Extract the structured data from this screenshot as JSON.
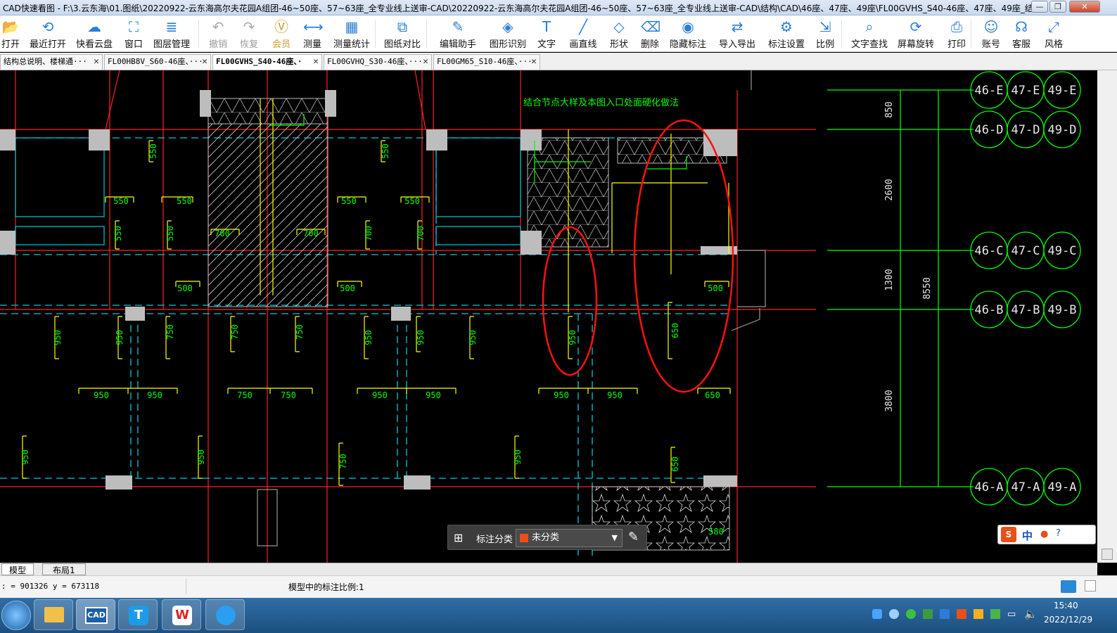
{
  "window": {
    "title": "CAD快速看图 - F:\\3.云东海\\01.图纸\\20220922-云东海高尔夫花园A组团-46~50座、57~63座_全专业线上送审-CAD\\20220922-云东海高尔夫花园A组团-46~50座、57~63座_全专业线上送审-CAD\\结构\\CAD\\46座、47座、49座\\FL00GVHS_S40-46座、47座、49座_结...",
    "min_label": "—",
    "max_label": "❐",
    "close_label": "✕"
  },
  "toolbar": {
    "items": [
      {
        "label": "打开",
        "icon": "folder-open-icon"
      },
      {
        "label": "最近打开",
        "icon": "recent-clock-icon"
      },
      {
        "label": "快看云盘",
        "icon": "cloud-icon"
      },
      {
        "label": "窗口",
        "icon": "window-fit-icon"
      },
      {
        "label": "图层管理",
        "icon": "layers-icon"
      },
      {
        "label": "撤销",
        "icon": "undo-icon"
      },
      {
        "label": "恢复",
        "icon": "redo-icon"
      },
      {
        "label": "会员",
        "icon": "vip-icon"
      },
      {
        "label": "测量",
        "icon": "measure-icon"
      },
      {
        "label": "测量统计",
        "icon": "measure-stats-icon"
      },
      {
        "label": "图纸对比",
        "icon": "compare-icon"
      },
      {
        "label": "编辑助手",
        "icon": "edit-assistant-icon"
      },
      {
        "label": "图形识别",
        "icon": "shape-recognition-icon"
      },
      {
        "label": "文字",
        "icon": "text-icon"
      },
      {
        "label": "画直线",
        "icon": "line-icon"
      },
      {
        "label": "形状",
        "icon": "shape-icon"
      },
      {
        "label": "删除",
        "icon": "eraser-icon"
      },
      {
        "label": "隐藏标注",
        "icon": "hide-eye-icon"
      },
      {
        "label": "导入导出",
        "icon": "import-export-icon"
      },
      {
        "label": "标注设置",
        "icon": "annotation-settings-icon"
      },
      {
        "label": "比例",
        "icon": "scale-icon"
      },
      {
        "label": "文字查找",
        "icon": "text-search-icon"
      },
      {
        "label": "屏幕旋转",
        "icon": "screen-rotate-icon"
      },
      {
        "label": "打印",
        "icon": "print-icon"
      },
      {
        "label": "账号",
        "icon": "account-icon"
      },
      {
        "label": "客服",
        "icon": "headset-icon"
      },
      {
        "label": "风格",
        "icon": "style-icon"
      }
    ]
  },
  "tabs": [
    {
      "label": "结构总说明、楼梯通···"
    },
    {
      "label": "FL00HB8V_S60-46座、···"
    },
    {
      "label": "FL00GVHS_S40-46座、·"
    },
    {
      "label": "FL00GVHQ_S30-46座、···"
    },
    {
      "label": "FL00GM65_S10-46座、···"
    }
  ],
  "tab_close": "✕",
  "drawing": {
    "note_text": "结合节点大样及本图入口处面硬化做法",
    "axes": {
      "rows": [
        [
          "46-E",
          "47-E",
          "49-E"
        ],
        [
          "46-D",
          "47-D",
          "49-D"
        ],
        [
          "46-C",
          "47-C",
          "49-C"
        ],
        [
          "46-B",
          "47-B",
          "49-B"
        ],
        [
          "46-A",
          "47-A",
          "49-A"
        ]
      ]
    },
    "vertical_dims": [
      "850",
      "2600",
      "1300",
      "3800",
      "8550"
    ],
    "labels_small": [
      "550",
      "550",
      "550",
      "550",
      "550",
      "550",
      "550",
      "550",
      "700",
      "700",
      "700",
      "700",
      "500",
      "500",
      "500",
      "950",
      "950",
      "750",
      "750",
      "750",
      "950",
      "950",
      "950",
      "950",
      "650",
      "950",
      "950",
      "750",
      "750",
      "950",
      "950",
      "950",
      "950",
      "650",
      "950",
      "950",
      "750",
      "950",
      "650",
      "580"
    ]
  },
  "layout_tabs": {
    "model": "模型",
    "layout1": "布局1"
  },
  "status": {
    "coords": ": = 901326 y = 673118",
    "scale_text": "模型中的标注比例:1"
  },
  "annotation_bar": {
    "label": "标注分类",
    "selected": "未分类",
    "swatch_color": "#e8501a"
  },
  "ime": {
    "text": "中"
  },
  "taskbar": {
    "time": "15:40",
    "date": "2022/12/29",
    "app_cad_label": "CAD"
  },
  "colors": {
    "red_line": "#ff1a1a",
    "cyan_dash": "#00c8d6",
    "yellow": "#ffff00",
    "green": "#00ff00"
  }
}
